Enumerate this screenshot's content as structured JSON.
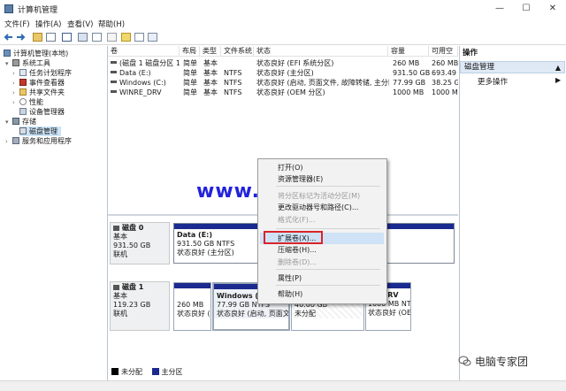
{
  "window": {
    "title": "计算机管理",
    "minimize": "—",
    "maximize": "☐",
    "close": "✕"
  },
  "menu": [
    "文件(F)",
    "操作(A)",
    "查看(V)",
    "帮助(H)"
  ],
  "tree": {
    "root": "计算机管理(本地)",
    "system_tools": "系统工具",
    "task_scheduler": "任务计划程序",
    "event_viewer": "事件查看器",
    "shared_folders": "共享文件夹",
    "performance": "性能",
    "device_manager": "设备管理器",
    "storage": "存储",
    "disk_management": "磁盘管理",
    "services": "服务和应用程序"
  },
  "volume_list": {
    "columns": [
      "卷",
      "布局",
      "类型",
      "文件系统",
      "状态",
      "容量",
      "可用空"
    ],
    "rows": [
      {
        "volume": "(磁盘 1 磁盘分区 1)",
        "layout": "简单",
        "type": "基本",
        "fs": "",
        "status": "状态良好 (EFI 系统分区)",
        "capacity": "260 MB",
        "free": "260 MB"
      },
      {
        "volume": "Data (E:)",
        "layout": "简单",
        "type": "基本",
        "fs": "NTFS",
        "status": "状态良好 (主分区)",
        "capacity": "931.50 GB",
        "free": "693.49"
      },
      {
        "volume": "Windows (C:)",
        "layout": "简单",
        "type": "基本",
        "fs": "NTFS",
        "status": "状态良好 (启动, 页面文件, 故障转储, 主分区)",
        "capacity": "77.99 GB",
        "free": "38.25 G"
      },
      {
        "volume": "WINRE_DRV",
        "layout": "简单",
        "type": "基本",
        "fs": "NTFS",
        "status": "状态良好 (OEM 分区)",
        "capacity": "1000 MB",
        "free": "1000 M"
      }
    ]
  },
  "disks": {
    "disk0": {
      "name": "磁盘 0",
      "type": "基本",
      "size": "931.50 GB",
      "state": "联机",
      "part": {
        "name": "Data  (E:)",
        "size": "931.50 GB NTFS",
        "status": "状态良好 (主分区)"
      }
    },
    "disk1": {
      "name": "磁盘 1",
      "type": "基本",
      "size": "119.23 GB",
      "state": "联机",
      "p1": {
        "size": "260 MB",
        "status": "状态良好 ("
      },
      "p2": {
        "name": "Windows  (C",
        "size": "77.99 GB NTFS",
        "status": "状态良好 (启动, 页面文("
      },
      "p3": {
        "size": "40.00 GB",
        "status": "未分配"
      },
      "p4": {
        "name": "RE_DRV",
        "size": "1000 MB NT",
        "status": "状态良好 (OE"
      }
    }
  },
  "legend": {
    "unallocated": "未分配",
    "primary": "主分区"
  },
  "actions": {
    "title": "操作",
    "section": "磁盘管理",
    "more": "更多操作"
  },
  "context_menu": {
    "open": "打开(O)",
    "explorer": "资源管理器(E)",
    "mark_active": "将分区标记为活动分区(M)",
    "change_letter": "更改驱动器号和路径(C)...",
    "format": "格式化(F)...",
    "extend": "扩展卷(X)...",
    "shrink": "压缩卷(H)...",
    "delete": "删除卷(D)...",
    "properties": "属性(P)",
    "help": "帮助(H)"
  },
  "watermark": "www. jdwxw .cn",
  "brand": "电脑专家团",
  "colors": {
    "primary_partition": "#1b2a8f",
    "unallocated": "#000000",
    "highlight_border": "#d8242b",
    "watermark": "#2222dd"
  }
}
